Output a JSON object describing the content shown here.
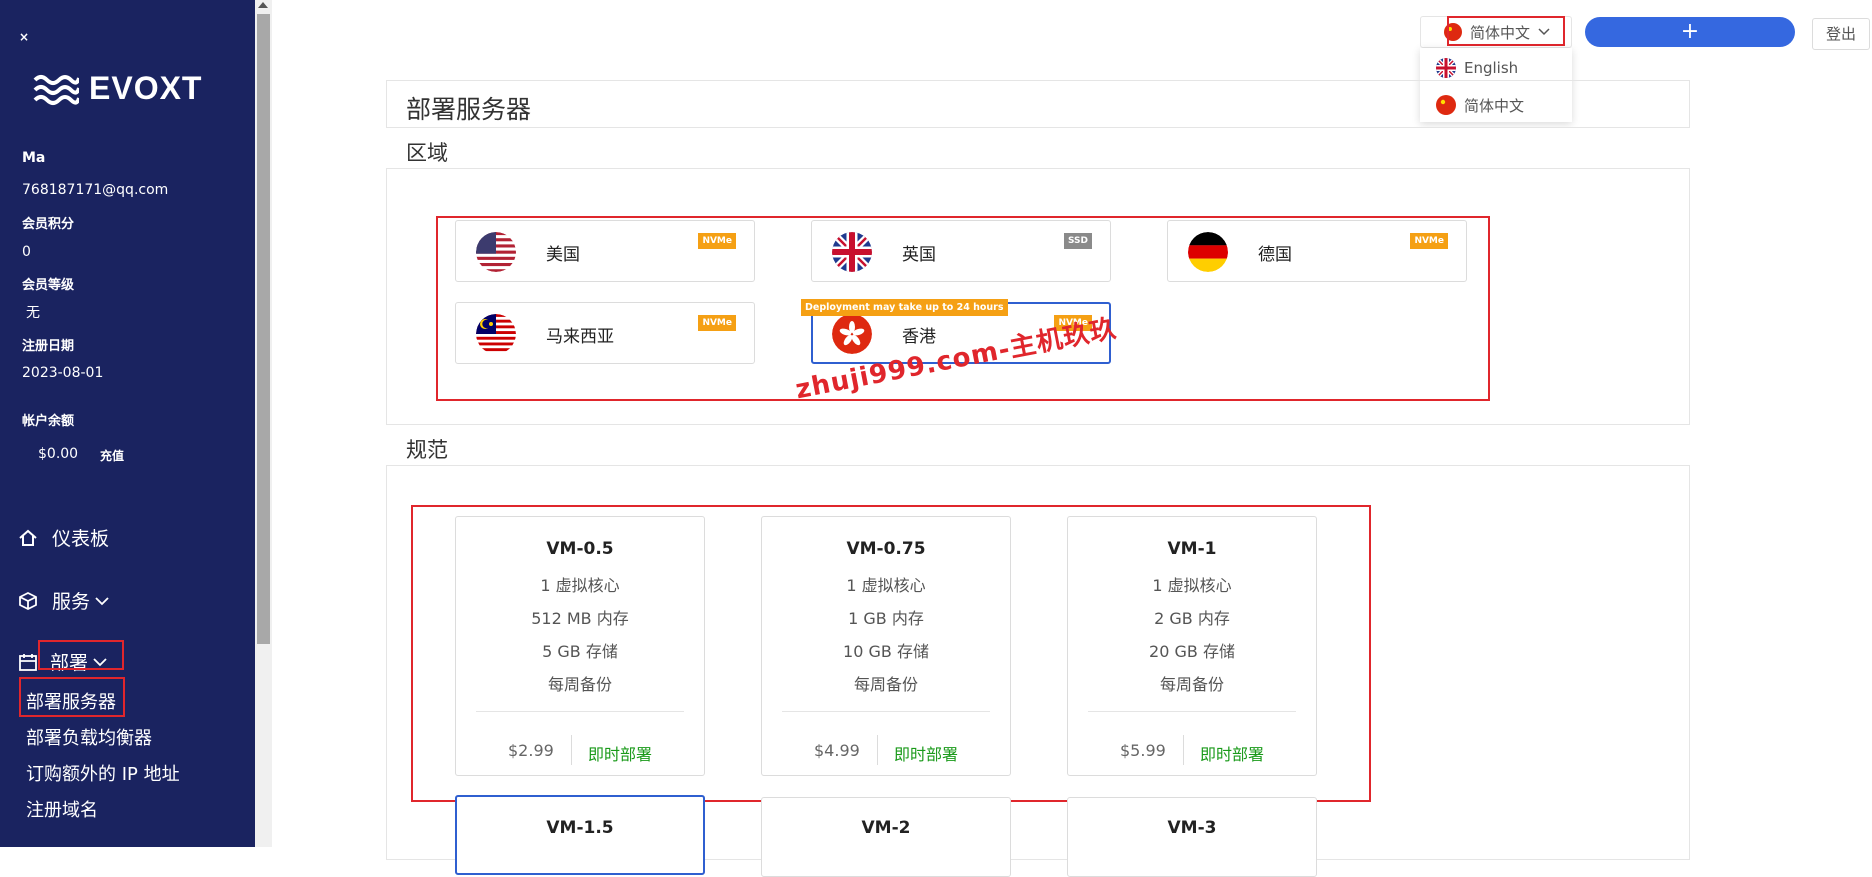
{
  "sidebar": {
    "close_label": "×",
    "logo_text": "EVOXT",
    "user_name": "Ma",
    "email": "768187171@qq.com",
    "points_label": "会员积分",
    "points_value": "0",
    "level_label": "会员等级",
    "level_value": "无",
    "reg_label": "注册日期",
    "reg_value": "2023-08-01",
    "balance_label": "帐户余额",
    "balance_value": "$0.00",
    "topup_label": "充值",
    "nav": {
      "dashboard": "仪表板",
      "services": "服务",
      "deploy": "部署"
    },
    "sub": {
      "deploy_server": "部署服务器",
      "deploy_lb": "部署负载均衡器",
      "extra_ip": "订购额外的 IP 地址",
      "register_domain": "注册域名"
    }
  },
  "header": {
    "lang_current": "简体中文",
    "lang_options": [
      "English",
      "简体中文"
    ],
    "add_label": "+",
    "logout_label": "登出"
  },
  "main": {
    "title": "部署服务器",
    "region_label": "区域",
    "spec_label": "规范",
    "deploy_note": "Deployment may take up to 24 hours",
    "watermark": "zhuji999.com-主机玖玖",
    "regions": [
      {
        "name": "美国",
        "badge": "NVMe"
      },
      {
        "name": "英国",
        "badge": "SSD"
      },
      {
        "name": "德国",
        "badge": "NVMe"
      },
      {
        "name": "马来西亚",
        "badge": "NVMe"
      },
      {
        "name": "香港",
        "badge": "NVMe"
      }
    ],
    "plans": [
      {
        "name": "VM-0.5",
        "cpu": "1 虚拟核心",
        "ram": "512 MB 内存",
        "disk": "5 GB 存储",
        "backup": "每周备份",
        "price": "$2.99",
        "deploy": "即时部署"
      },
      {
        "name": "VM-0.75",
        "cpu": "1 虚拟核心",
        "ram": "1 GB 内存",
        "disk": "10 GB 存储",
        "backup": "每周备份",
        "price": "$4.99",
        "deploy": "即时部署"
      },
      {
        "name": "VM-1",
        "cpu": "1 虚拟核心",
        "ram": "2 GB 内存",
        "disk": "20 GB 存储",
        "backup": "每周备份",
        "price": "$5.99",
        "deploy": "即时部署"
      },
      {
        "name": "VM-1.5"
      },
      {
        "name": "VM-2"
      },
      {
        "name": "VM-3"
      }
    ]
  }
}
